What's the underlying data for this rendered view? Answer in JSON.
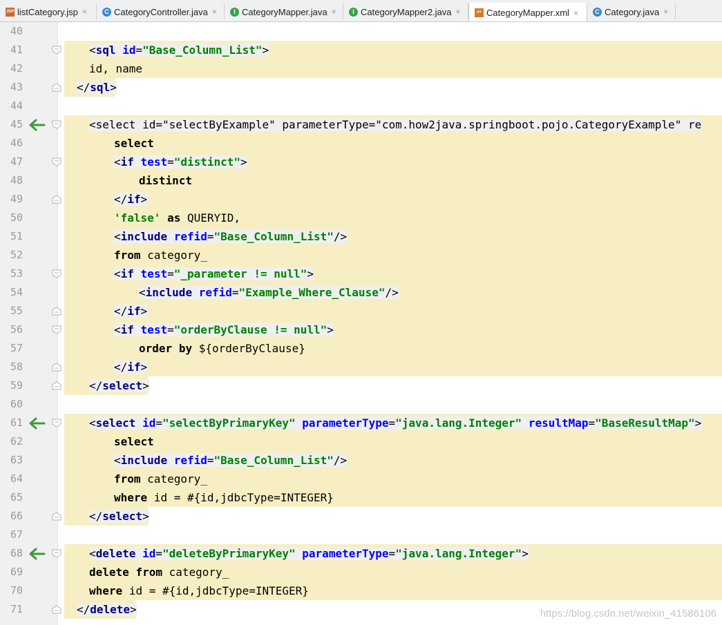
{
  "tabs": [
    {
      "label": "listCategory.jsp",
      "icon": "jsp-file-icon",
      "active": false
    },
    {
      "label": "CategoryController.java",
      "icon": "class-icon",
      "active": false
    },
    {
      "label": "CategoryMapper.java",
      "icon": "interface-icon",
      "active": false
    },
    {
      "label": "CategoryMapper2.java",
      "icon": "interface-icon",
      "active": false
    },
    {
      "label": "CategoryMapper.xml",
      "icon": "xml-file-icon",
      "active": true
    },
    {
      "label": "Category.java",
      "icon": "class-icon",
      "active": false
    }
  ],
  "close_glyph": "×",
  "lines": [
    {
      "n": "40",
      "text": ""
    },
    {
      "n": "41",
      "text": "<sql id=\"Base_Column_List\">"
    },
    {
      "n": "42",
      "text": "id, name"
    },
    {
      "n": "43",
      "text": "</sql>"
    },
    {
      "n": "44",
      "text": ""
    },
    {
      "n": "45",
      "text": "<select id=\"selectByExample\" parameterType=\"com.how2java.springboot.pojo.CategoryExample\" re"
    },
    {
      "n": "46",
      "text": "select"
    },
    {
      "n": "47",
      "text": "<if test=\"distinct\">"
    },
    {
      "n": "48",
      "text": "distinct"
    },
    {
      "n": "49",
      "text": "</if>"
    },
    {
      "n": "50",
      "text": "'false' as QUERYID,"
    },
    {
      "n": "51",
      "text": "<include refid=\"Base_Column_List\"/>"
    },
    {
      "n": "52",
      "text": "from category_"
    },
    {
      "n": "53",
      "text": "<if test=\"_parameter != null\">"
    },
    {
      "n": "54",
      "text": "<include refid=\"Example_Where_Clause\"/>"
    },
    {
      "n": "55",
      "text": "</if>"
    },
    {
      "n": "56",
      "text": "<if test=\"orderByClause != null\">"
    },
    {
      "n": "57",
      "text": "order by ${orderByClause}"
    },
    {
      "n": "58",
      "text": "</if>"
    },
    {
      "n": "59",
      "text": "</select>"
    },
    {
      "n": "60",
      "text": ""
    },
    {
      "n": "61",
      "text": "<select id=\"selectByPrimaryKey\" parameterType=\"java.lang.Integer\" resultMap=\"BaseResultMap\">"
    },
    {
      "n": "62",
      "text": "select"
    },
    {
      "n": "63",
      "text": "<include refid=\"Base_Column_List\"/>"
    },
    {
      "n": "64",
      "text": "from category_"
    },
    {
      "n": "65",
      "text": "where id = #{id,jdbcType=INTEGER}"
    },
    {
      "n": "66",
      "text": "</select>"
    },
    {
      "n": "67",
      "text": ""
    },
    {
      "n": "68",
      "text": "<delete id=\"deleteByPrimaryKey\" parameterType=\"java.lang.Integer\">"
    },
    {
      "n": "69",
      "text": "delete from category_"
    },
    {
      "n": "70",
      "text": "where id = #{id,jdbcType=INTEGER}"
    },
    {
      "n": "71",
      "text": "</delete>"
    }
  ],
  "watermark": "https://blog.csdn.net/weixin_41586106",
  "colors": {
    "highlight": "#f7efc3",
    "arrow": "#3a9b3a",
    "keyword": "#000080",
    "string": "#008000",
    "attribute": "#0000ff"
  }
}
